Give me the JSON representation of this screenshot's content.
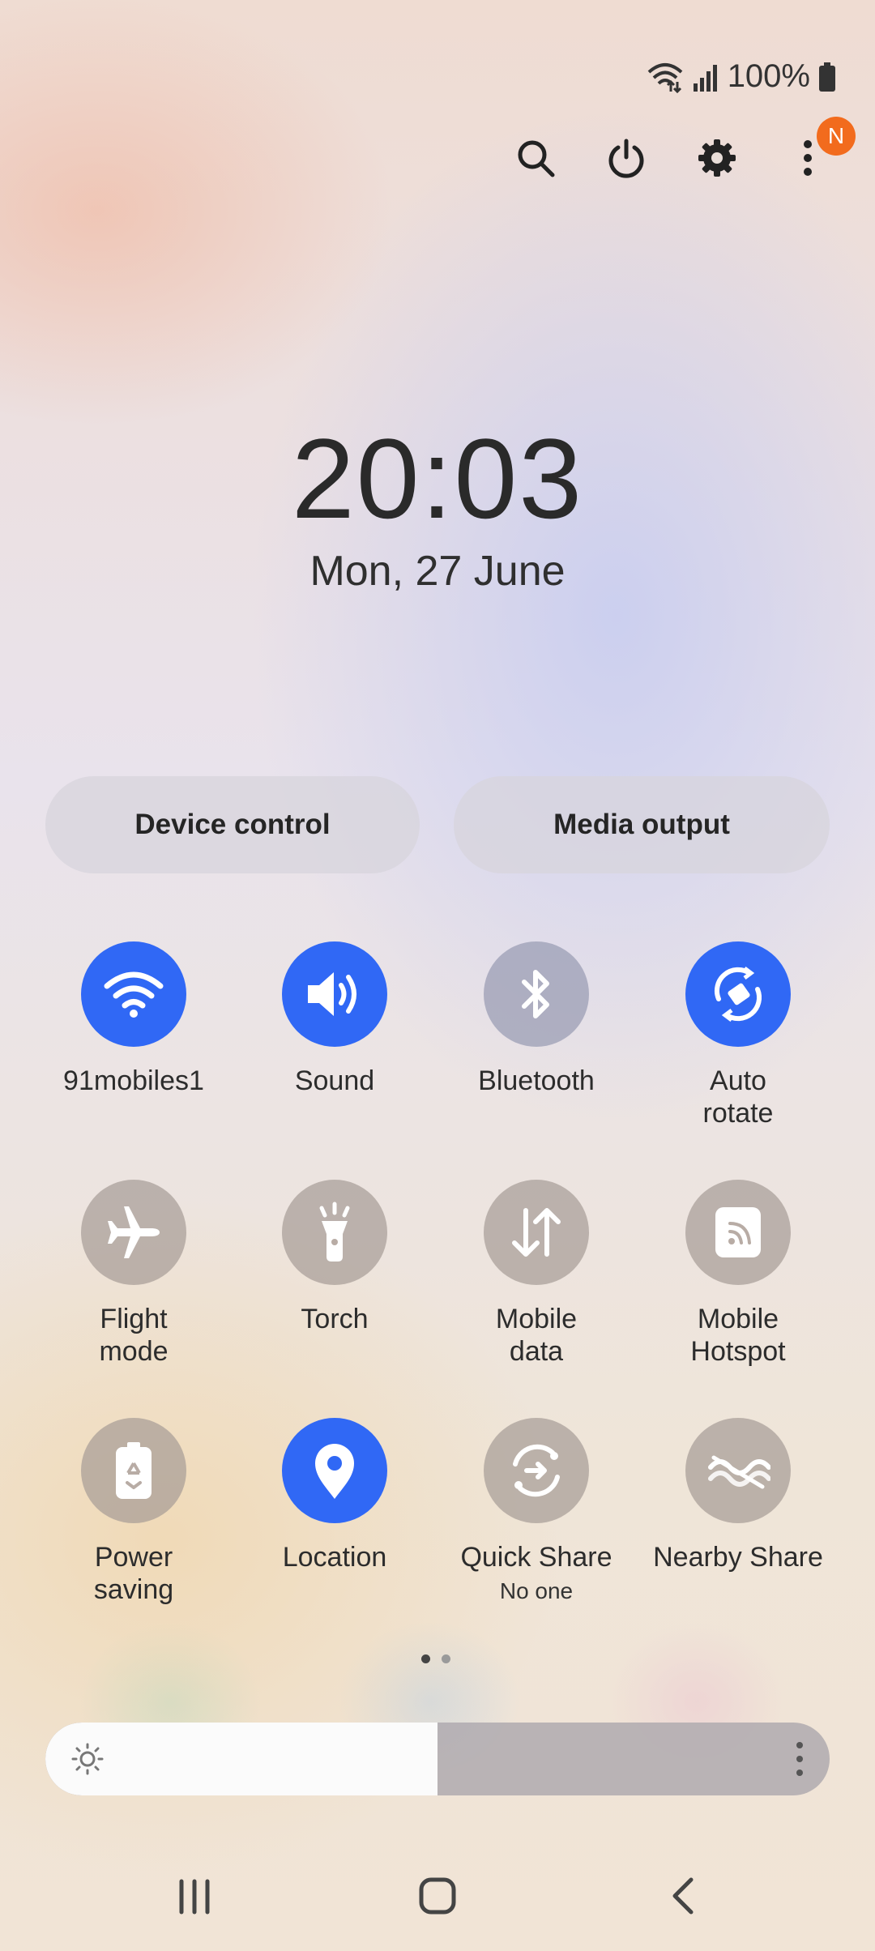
{
  "status_bar": {
    "battery_text": "100%"
  },
  "quick_actions": {
    "notification_badge": "N"
  },
  "clock": {
    "time": "20:03",
    "date": "Mon, 27 June"
  },
  "controls": {
    "device_control": "Device control",
    "media_output": "Media output"
  },
  "tiles": [
    {
      "label": "91mobiles1",
      "state": "on",
      "icon": "wifi-icon"
    },
    {
      "label": "Sound",
      "state": "on",
      "icon": "sound-icon"
    },
    {
      "label": "Bluetooth",
      "state": "off",
      "icon": "bluetooth-icon"
    },
    {
      "label": "Auto\nrotate",
      "state": "on",
      "icon": "auto-rotate-icon"
    },
    {
      "label": "Flight\nmode",
      "state": "off",
      "icon": "airplane-icon"
    },
    {
      "label": "Torch",
      "state": "off",
      "icon": "torch-icon"
    },
    {
      "label": "Mobile\ndata",
      "state": "off",
      "icon": "mobile-data-icon"
    },
    {
      "label": "Mobile\nHotspot",
      "state": "off",
      "icon": "hotspot-icon"
    },
    {
      "label": "Power\nsaving",
      "state": "off",
      "icon": "power-saving-icon"
    },
    {
      "label": "Location",
      "state": "on",
      "icon": "location-icon"
    },
    {
      "label": "Quick Share",
      "sublabel": "No one",
      "state": "off",
      "icon": "quick-share-icon"
    },
    {
      "label": "Nearby Share",
      "state": "off",
      "icon": "nearby-share-icon"
    }
  ],
  "pager": {
    "pages": 2,
    "current": 1
  },
  "brightness": {
    "level": 0.5
  },
  "colors": {
    "accent": "#3068f5",
    "badge": "#f26b1d"
  }
}
